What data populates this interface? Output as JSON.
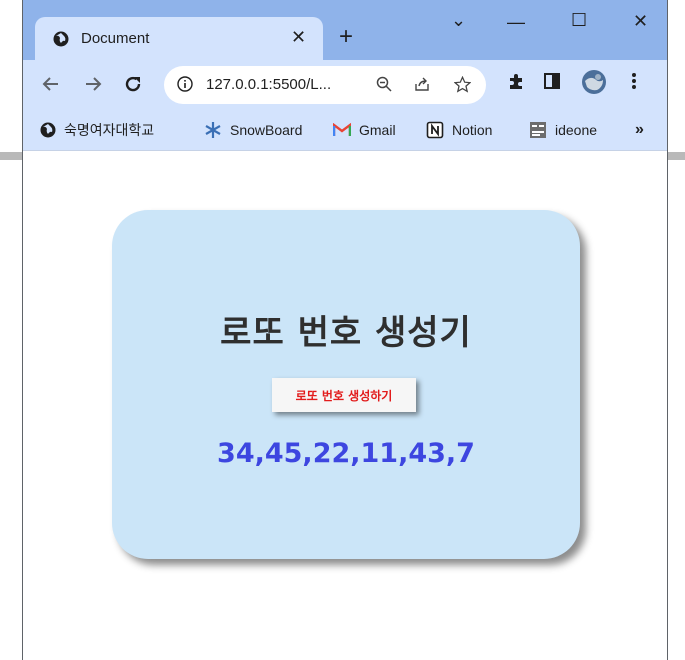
{
  "browser": {
    "tab_title": "Document",
    "tab_close": "✕",
    "new_tab": "+",
    "url": "127.0.0.1:5500/L...",
    "window_controls": {
      "tab_search": "⌄",
      "minimize": "—",
      "maximize": "☐",
      "close": "✕"
    }
  },
  "bookmarks": [
    {
      "label": "숙명여자대학교",
      "icon": "globe-icon"
    },
    {
      "label": "SnowBoard",
      "icon": "snowflake-icon"
    },
    {
      "label": "Gmail",
      "icon": "gmail-icon"
    },
    {
      "label": "Notion",
      "icon": "notion-icon"
    },
    {
      "label": "ideone",
      "icon": "ideone-icon"
    }
  ],
  "bookmarks_more": "»",
  "page": {
    "title": "로또 번호 생성기",
    "button_label": "로또 번호 생성하기",
    "numbers": "34,45,22,11,43,7"
  },
  "colors": {
    "card_bg": "#cbe5f8",
    "numbers": "#3d46e0",
    "button_text": "#e21b1b",
    "title_bar": "#8fb3ea",
    "toolbar": "#d3e3fd"
  }
}
